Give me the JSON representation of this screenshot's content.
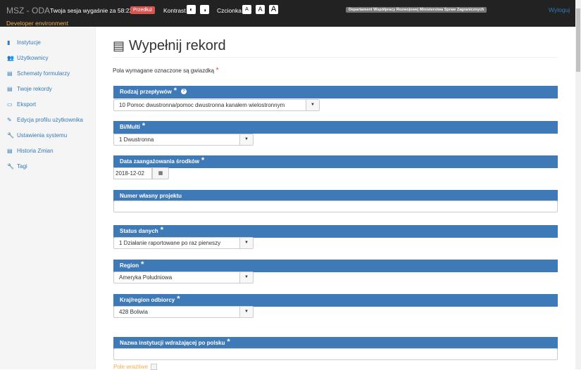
{
  "topbar": {
    "brand": "MSZ - ODA",
    "session": "Twoja sesja wygaśnie za 58:22",
    "extend": "Przedłuż",
    "contrast": "Kontrast",
    "font": "Czcionka",
    "font_a": "A",
    "department": "Departament Współpracy Rozwojowej Ministerstwa Spraw Zagranicznych",
    "logout": "Wyloguj",
    "env": "Developer environment"
  },
  "sidebar": {
    "items": [
      {
        "label": "Instytucje",
        "icon": "book-icon"
      },
      {
        "label": "Użytkownicy",
        "icon": "users-icon"
      },
      {
        "label": "Schematy formularzy",
        "icon": "list-alt-icon"
      },
      {
        "label": "Twoje rekordy",
        "icon": "list-alt-icon"
      },
      {
        "label": "Eksport",
        "icon": "laptop-icon"
      },
      {
        "label": "Edycja profilu użytkownika",
        "icon": "edit-icon"
      },
      {
        "label": "Ustawienia systemu",
        "icon": "wrench-icon"
      },
      {
        "label": "Historia Zmian",
        "icon": "list-alt-icon"
      },
      {
        "label": "Tagi",
        "icon": "wrench-icon"
      }
    ]
  },
  "main": {
    "title": "Wypełnij rekord",
    "required_note": "Pola wymagane oznaczone są gwiazdką",
    "star": "*",
    "fields": [
      {
        "label": "Rodzaj przepływów",
        "value": "10 Pomoc dwustronna/pomoc dwustronna kanałem wielostronnym"
      },
      {
        "label": "Bi/Multi",
        "value": "1 Dwustronna"
      },
      {
        "label": "Data zaangażowania środków",
        "value": "2018-12-02"
      },
      {
        "label": "Numer własny projektu",
        "value": ""
      },
      {
        "label": "Status danych",
        "value": "1 Działanie raportowane po raz pierwszy"
      },
      {
        "label": "Region",
        "value": "Ameryka Południowa"
      },
      {
        "label": "Kraj/region odbiorcy",
        "value": "428 Boliwia"
      },
      {
        "label": "Nazwa instytucji wdrażającej po polsku",
        "value": ""
      }
    ],
    "sensitive": "Pole wrażliwe"
  }
}
